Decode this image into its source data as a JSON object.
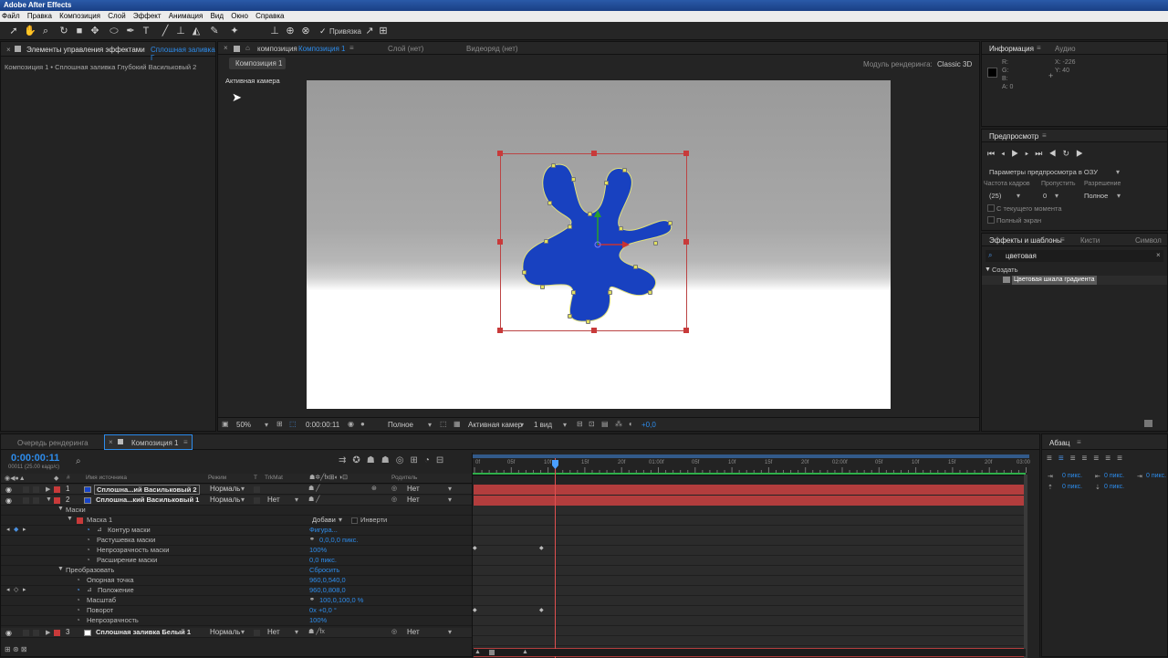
{
  "app_title": "Adobe After Effects",
  "menu": [
    "Файл",
    "Правка",
    "Композиция",
    "Слой",
    "Эффект",
    "Анимация",
    "Вид",
    "Окно",
    "Справка"
  ],
  "toolbar": {
    "snap_label": "Привязка"
  },
  "effects_panel": {
    "tab": "Элементы управления эффектами",
    "tab_link": "Сплошная заливка Г",
    "breadcrumb": "Композиция 1 • Сплошная заливка Глубокий Васильковый 2"
  },
  "comp_panel": {
    "tab_prefix": "композиция",
    "tab_comp": "Композиция 1",
    "layer_tab": "Слой (нет)",
    "footage_tab": "Видеоряд (нет)",
    "subtab": "Композиция 1",
    "renderer_label": "Модуль рендеринга:",
    "renderer_value": "Classic 3D",
    "active_camera": "Активная камера",
    "footer": {
      "zoom": "50%",
      "timecode": "0:00:00:11",
      "resolution": "Полное",
      "camera": "Активная камер",
      "views": "1 вид",
      "exposure": "+0,0"
    }
  },
  "info_panel": {
    "tab": "Информация",
    "tab2": "Аудио",
    "r": "R:",
    "g": "G:",
    "b": "B:",
    "a": "A: 0",
    "x": "X: -226",
    "y": "Y: 40"
  },
  "preview_panel": {
    "tab": "Предпросмотр",
    "ram_options": "Параметры предпросмотра в ОЗУ",
    "fps_label": "Частота кадров",
    "skip_label": "Пропустить",
    "res_label": "Разрешение",
    "fps_value": "(25)",
    "skip_value": "0",
    "res_value": "Полное",
    "from_current": "С текущего момента",
    "full_screen": "Полный экран"
  },
  "effects_presets": {
    "tab": "Эффекты и шаблоны",
    "tab2": "Кисти",
    "tab3": "Символ",
    "search": "цветовая",
    "category": "Создать",
    "item": "Цветовая шкала градиента"
  },
  "timeline": {
    "tab_render": "Очередь рендеринга",
    "tab_comp": "Композиция 1",
    "timecode": "0:00:00:11",
    "frame_info": "00011 (25.00 кадр/с)",
    "columns": {
      "num": "#",
      "source": "Имя источника",
      "mode": "Режим",
      "t": "T",
      "trkmat": "TrkMat",
      "parent": "Родитель"
    },
    "ruler": [
      "0f",
      "05f",
      "10f",
      "15f",
      "20f",
      "01:00f",
      "05f",
      "10f",
      "15f",
      "20f",
      "02:00f",
      "05f",
      "10f",
      "15f",
      "20f",
      "03:00"
    ],
    "layers": [
      {
        "num": "1",
        "name": "Сплошна...ий Васильковый 2",
        "mode": "Нормаль",
        "trkmat": "",
        "parent": "Нет",
        "color": "#1845c8"
      },
      {
        "num": "2",
        "name": "Сплошна...кий Васильковый 1",
        "mode": "Нормаль",
        "trkmat": "Нет",
        "parent": "Нет",
        "color": "#1845c8"
      },
      {
        "num": "3",
        "name": "Сплошная заливка Белый 1",
        "mode": "Нормаль",
        "trkmat": "Нет",
        "parent": "Нет",
        "color": "#ffffff"
      }
    ],
    "props": {
      "masks": "Маски",
      "mask1": "Маска 1",
      "mask_mode": "Добави",
      "inverted": "Инверти",
      "path": "Контур маски",
      "path_v": "Фигура...",
      "feather": "Растушевка маски",
      "feather_v": "0,0,0,0 пикс.",
      "opacity": "Непрозрачность маски",
      "opacity_v": "100%",
      "expansion": "Расширение маски",
      "expansion_v": "0,0 пикс.",
      "transform": "Преобразовать",
      "reset": "Сбросить",
      "anchor": "Опорная точка",
      "anchor_v": "960,0,540,0",
      "position": "Положение",
      "position_v": "960,0,808,0",
      "scale": "Масштаб",
      "scale_v": "100,0,100,0 %",
      "rotation": "Поворот",
      "rotation_v": "0x +0,0 °",
      "layer_opacity": "Непрозрачность",
      "layer_opacity_v": "100%"
    }
  },
  "paragraph_panel": {
    "tab": "Абзац",
    "v1": "0 пикс.",
    "v2": "0 пикс.",
    "v3": "0 пикс.",
    "v4": "0 пикс.",
    "v5": "0 пикс."
  }
}
